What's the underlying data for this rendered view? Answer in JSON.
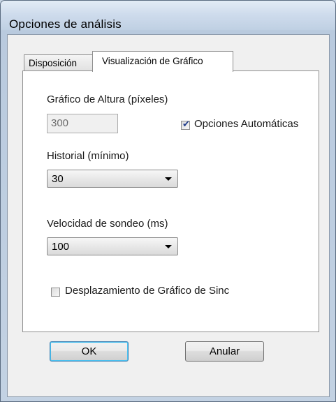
{
  "window": {
    "title": "Opciones de análisis"
  },
  "tabs": [
    {
      "label": "Disposición",
      "selected": false
    },
    {
      "label": "Visualización de Gráfico",
      "selected": true
    }
  ],
  "graph_height": {
    "label": "Gráfico de Altura (píxeles)",
    "value": "300",
    "enabled": false
  },
  "auto_options": {
    "label": "Opciones Automáticas",
    "checked": true
  },
  "history": {
    "label": "Historial (mínimo)",
    "value": "30"
  },
  "polling": {
    "label": "Velocidad de sondeo (ms)",
    "value": "100"
  },
  "sync_scroll": {
    "label": "Desplazamiento de Gráfico de Sinc",
    "checked": false
  },
  "buttons": {
    "ok": "OK",
    "cancel": "Anular"
  },
  "colors": {
    "default_button_border": "#3c7fb1",
    "check_mark": "#223e8c",
    "disabled_field": "#f0f0f0"
  }
}
